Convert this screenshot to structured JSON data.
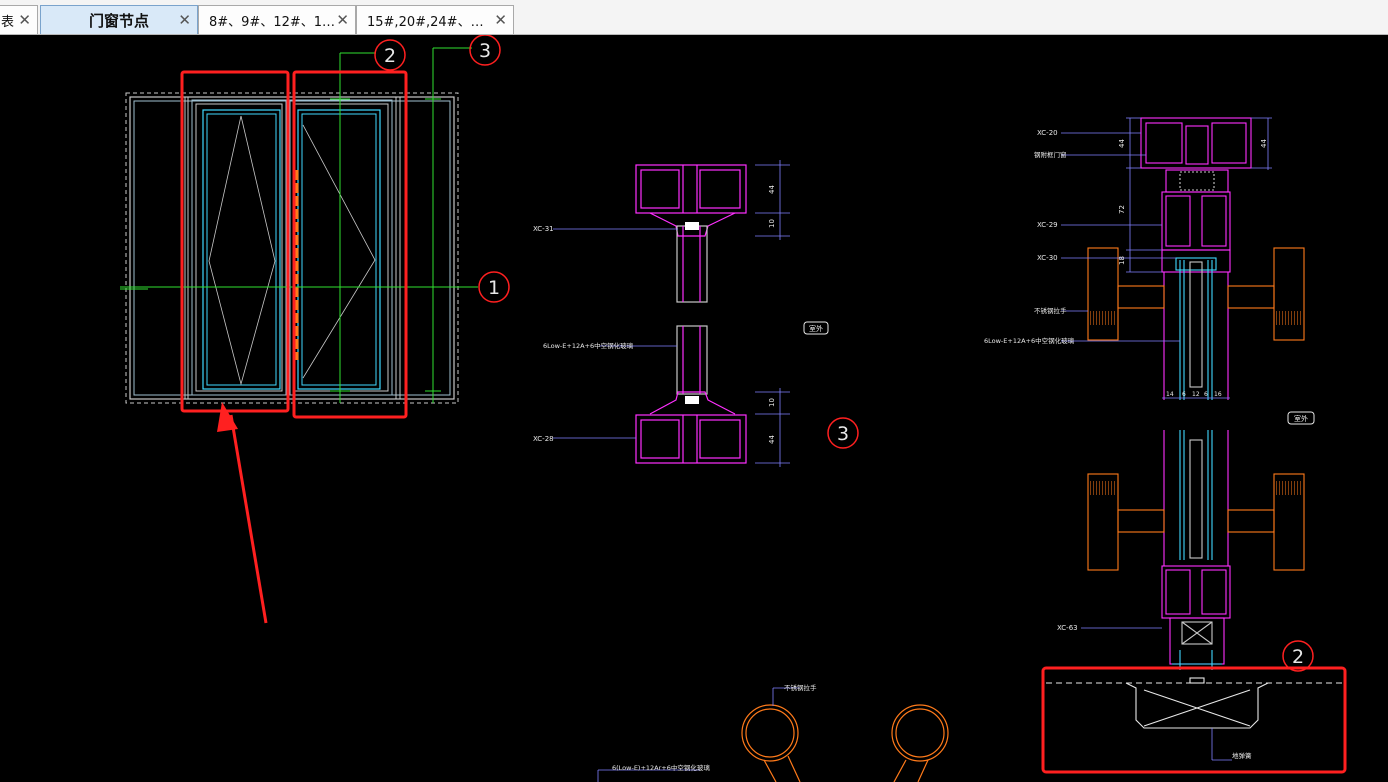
{
  "tabs": [
    {
      "label": "表",
      "active": false
    },
    {
      "label": "门窗节点",
      "active": true
    },
    {
      "label": "8#、9#、12#、1…",
      "active": false
    },
    {
      "label": "15#,20#,24#、…",
      "active": false
    }
  ],
  "tab_close_glyph": "✕",
  "markers": {
    "m1": "1",
    "m2": "2",
    "m3": "3"
  },
  "labels": {
    "xc31": "XC-31",
    "xc28": "XC-28",
    "glass_mid": "6Low-E+12A+6中空钢化玻璃",
    "outdoor": "室外",
    "outdoor2": "室外",
    "xc20": "XC-20",
    "attach_frame": "钢附框门窗",
    "xc29": "XC-29",
    "xc30": "XC-30",
    "handle_right": "不锈钢拉手",
    "glass_right": "6Low-E+12A+6中空钢化玻璃",
    "xc63": "XC-63",
    "floor_spring": "地弹簧",
    "handle_bottom": "不锈钢拉手",
    "glass_bottom": "6(Low-E)+12Ar+6中空钢化玻璃"
  },
  "dims": {
    "d44a": "44",
    "d10a": "10",
    "d10b": "10",
    "d44b": "44",
    "d44c": "44",
    "d44d": "44",
    "d72": "72",
    "d18": "18",
    "d14a": "14",
    "d6a": "6",
    "d12": "12",
    "d6b": "6",
    "d16": "16"
  },
  "colors": {
    "highlight": "#ff2020",
    "frame": "#c8c8c8",
    "glass_frame": "#40d8ff",
    "grid": "#30e030",
    "profile": "#ff30ff",
    "handle": "#ff7a1a",
    "dim": "#8080ff"
  }
}
